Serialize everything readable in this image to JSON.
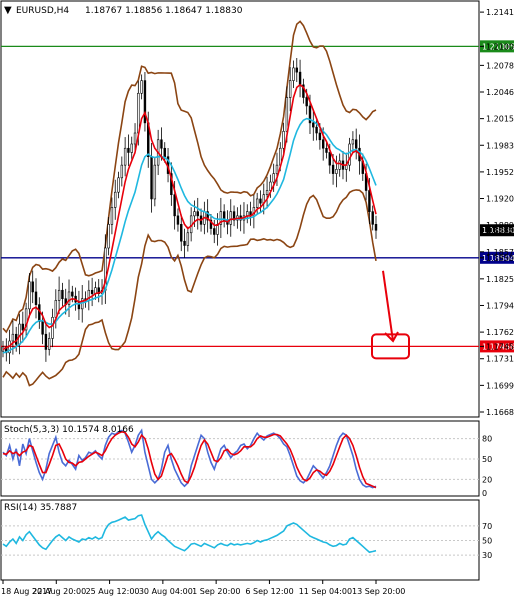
{
  "header": {
    "symbol_timeframe": "EURUSD,H4",
    "ohlc": "1.18767 1.18856 1.18647 1.18830"
  },
  "colors": {
    "up": "#000000",
    "down": "#000000",
    "ma_red": "#e8000b",
    "ma_cyan": "#1fb8e0",
    "bollinger": "#8b4513",
    "level_green": "#1a8a1a",
    "level_blue": "#00008b",
    "level_red": "#e8000b",
    "stoch_main": "#4a6cd6",
    "stoch_signal": "#e8000b",
    "rsi": "#1fb8e0",
    "arrow": "#e8000b"
  },
  "chart_data": [
    {
      "type": "candlestick",
      "title": "EURUSD,H4",
      "ylim": [
        1.1668,
        1.21435
      ],
      "y_ticks": [
        "1.21410",
        "1.21005",
        "1.20780",
        "1.20465",
        "1.20150",
        "1.19835",
        "1.19520",
        "1.19205",
        "1.18890",
        "1.18830",
        "1.18575",
        "1.18504",
        "1.18255",
        "1.17940",
        "1.17625",
        "1.17456",
        "1.17310",
        "1.16995",
        "1.16680"
      ],
      "price_label_current": "1.18830",
      "levels": [
        {
          "price": 1.21005,
          "label": "1.21005",
          "color": "#1a8a1a"
        },
        {
          "price": 1.18504,
          "label": "1.18504",
          "color": "#00008b"
        },
        {
          "price": 1.17456,
          "label": "1.17456",
          "color": "#e8000b"
        }
      ],
      "x_labels": [
        "18 Aug 2017",
        "22 Aug 20:00",
        "25 Aug 12:00",
        "30 Aug 04:00",
        "1 Sep 20:00",
        "6 Sep 12:00",
        "11 Sep 04:00",
        "13 Sep 20:00"
      ],
      "close": [
        1.1745,
        1.1738,
        1.1752,
        1.176,
        1.1748,
        1.1772,
        1.1765,
        1.179,
        1.1822,
        1.181,
        1.1795,
        1.1775,
        1.176,
        1.1742,
        1.1755,
        1.178,
        1.18,
        1.1812,
        1.1802,
        1.1795,
        1.181,
        1.1805,
        1.1798,
        1.179,
        1.1802,
        1.18,
        1.1812,
        1.1808,
        1.1815,
        1.1808,
        1.1812,
        1.1862,
        1.189,
        1.191,
        1.1928,
        1.1945,
        1.196,
        1.198,
        1.1975,
        1.1985,
        1.1998,
        1.2045,
        1.206,
        1.201,
        1.197,
        1.192,
        1.196,
        1.199,
        1.198,
        1.197,
        1.195,
        1.1925,
        1.19,
        1.189,
        1.187,
        1.1865,
        1.188,
        1.19,
        1.1905,
        1.19,
        1.189,
        1.1905,
        1.1895,
        1.1885,
        1.1878,
        1.189,
        1.1905,
        1.1895,
        1.189,
        1.1905,
        1.1895,
        1.19,
        1.1895,
        1.19,
        1.1905,
        1.19,
        1.191,
        1.192,
        1.1915,
        1.1925,
        1.193,
        1.194,
        1.195,
        1.196,
        1.198,
        1.2,
        1.204,
        1.206,
        1.2075,
        1.207,
        1.2055,
        1.204,
        1.203,
        1.201,
        1.2005,
        1.1998,
        1.199,
        1.198,
        1.1975,
        1.196,
        1.195,
        1.1955,
        1.1965,
        1.1955,
        1.196,
        1.1985,
        1.199,
        1.198,
        1.1965,
        1.195,
        1.193,
        1.1905,
        1.189,
        1.1883
      ],
      "ma_red": [
        1.1742,
        1.1744,
        1.1746,
        1.175,
        1.1752,
        1.1758,
        1.1762,
        1.177,
        1.1782,
        1.179,
        1.1792,
        1.1788,
        1.1782,
        1.1772,
        1.1768,
        1.177,
        1.1778,
        1.1788,
        1.1792,
        1.1795,
        1.18,
        1.1802,
        1.1801,
        1.1798,
        1.1799,
        1.18,
        1.1803,
        1.1805,
        1.1808,
        1.1809,
        1.181,
        1.1822,
        1.184,
        1.186,
        1.188,
        1.19,
        1.192,
        1.194,
        1.1955,
        1.1965,
        1.1975,
        1.1995,
        1.2015,
        1.2022,
        1.201,
        1.199,
        1.198,
        1.1975,
        1.197,
        1.1965,
        1.1958,
        1.1945,
        1.193,
        1.1915,
        1.19,
        1.189,
        1.1885,
        1.1888,
        1.1893,
        1.1896,
        1.1895,
        1.1898,
        1.1897,
        1.1893,
        1.1889,
        1.1889,
        1.1893,
        1.1894,
        1.1893,
        1.1896,
        1.1896,
        1.1897,
        1.1897,
        1.1898,
        1.19,
        1.19,
        1.1903,
        1.1908,
        1.191,
        1.1915,
        1.192,
        1.1928,
        1.1936,
        1.1945,
        1.1958,
        1.1972,
        1.1995,
        1.2018,
        1.204,
        1.2052,
        1.2055,
        1.2052,
        1.2045,
        1.2035,
        1.2025,
        1.2015,
        1.2005,
        1.1995,
        1.1988,
        1.1978,
        1.1968,
        1.1962,
        1.1962,
        1.196,
        1.196,
        1.1968,
        1.1975,
        1.1977,
        1.1973,
        1.1965,
        1.1952,
        1.1935,
        1.1918,
        1.1902
      ],
      "ma_cyan": [
        1.1738,
        1.1739,
        1.1741,
        1.1743,
        1.1745,
        1.1748,
        1.1752,
        1.1757,
        1.1764,
        1.177,
        1.1774,
        1.1776,
        1.1776,
        1.1774,
        1.1772,
        1.1772,
        1.1775,
        1.178,
        1.1784,
        1.1787,
        1.1791,
        1.1794,
        1.1796,
        1.1796,
        1.1797,
        1.1798,
        1.18,
        1.1801,
        1.1803,
        1.1804,
        1.1806,
        1.1813,
        1.1824,
        1.1836,
        1.185,
        1.1864,
        1.1878,
        1.1893,
        1.1906,
        1.1917,
        1.1928,
        1.1944,
        1.196,
        1.197,
        1.1973,
        1.197,
        1.1969,
        1.197,
        1.197,
        1.1969,
        1.1966,
        1.196,
        1.1952,
        1.1943,
        1.1933,
        1.1924,
        1.1917,
        1.1913,
        1.1911,
        1.1909,
        1.1906,
        1.1905,
        1.1903,
        1.19,
        1.1897,
        1.1896,
        1.1896,
        1.1896,
        1.1895,
        1.1896,
        1.1896,
        1.1896,
        1.1896,
        1.1897,
        1.1897,
        1.1898,
        1.1899,
        1.1902,
        1.1904,
        1.1907,
        1.191,
        1.1915,
        1.192,
        1.1926,
        1.1934,
        1.1943,
        1.1958,
        1.1973,
        1.1989,
        1.2,
        1.2008,
        1.2013,
        1.2015,
        1.2014,
        1.2012,
        1.2009,
        1.2005,
        1.2,
        1.1996,
        1.199,
        1.1984,
        1.198,
        1.1978,
        1.1975,
        1.1973,
        1.1975,
        1.1978,
        1.1978,
        1.1976,
        1.1972,
        1.1965,
        1.1956,
        1.1946,
        1.1936
      ]
    },
    {
      "type": "line",
      "title": "Stoch(5,3,3) 10.1574 8.0166",
      "ylim": [
        0,
        100
      ],
      "y_ticks": [
        "80",
        "50",
        "20",
        "0"
      ],
      "series": [
        {
          "name": "main",
          "values": [
            60,
            55,
            70,
            50,
            65,
            40,
            72,
            58,
            80,
            62,
            45,
            30,
            20,
            35,
            58,
            70,
            82,
            60,
            45,
            40,
            48,
            42,
            35,
            55,
            48,
            52,
            60,
            58,
            62,
            55,
            50,
            70,
            82,
            88,
            86,
            90,
            92,
            88,
            75,
            60,
            70,
            85,
            92,
            60,
            40,
            20,
            15,
            20,
            35,
            60,
            70,
            50,
            35,
            25,
            15,
            10,
            15,
            40,
            55,
            70,
            85,
            80,
            60,
            45,
            35,
            50,
            65,
            70,
            60,
            52,
            58,
            62,
            70,
            72,
            65,
            70,
            80,
            88,
            82,
            78,
            84,
            86,
            88,
            85,
            80,
            72,
            68,
            55,
            40,
            25,
            18,
            15,
            20,
            30,
            40,
            35,
            28,
            22,
            30,
            40,
            55,
            70,
            82,
            88,
            85,
            70,
            55,
            35,
            20,
            12,
            9,
            10,
            8,
            10
          ]
        },
        {
          "name": "signal",
          "values": [
            58,
            57,
            62,
            58,
            60,
            55,
            60,
            62,
            70,
            68,
            55,
            42,
            30,
            30,
            42,
            55,
            70,
            72,
            62,
            50,
            45,
            44,
            40,
            45,
            46,
            50,
            54,
            57,
            60,
            58,
            55,
            62,
            72,
            80,
            85,
            88,
            90,
            89,
            82,
            72,
            68,
            75,
            85,
            80,
            65,
            45,
            28,
            20,
            25,
            40,
            55,
            58,
            50,
            40,
            28,
            18,
            15,
            25,
            38,
            55,
            70,
            78,
            72,
            60,
            48,
            46,
            52,
            62,
            64,
            58,
            56,
            58,
            62,
            68,
            68,
            68,
            72,
            80,
            84,
            82,
            82,
            84,
            86,
            86,
            84,
            78,
            72,
            64,
            52,
            38,
            28,
            20,
            18,
            22,
            30,
            34,
            32,
            28,
            26,
            32,
            42,
            55,
            68,
            80,
            85,
            80,
            70,
            55,
            38,
            24,
            14,
            12,
            10,
            8
          ]
        }
      ]
    },
    {
      "type": "line",
      "title": "RSI(14) 35.7887",
      "ylim": [
        0,
        100
      ],
      "y_ticks": [
        "70",
        "50",
        "30"
      ],
      "series": [
        {
          "name": "rsi",
          "values": [
            45,
            42,
            48,
            52,
            46,
            55,
            50,
            58,
            62,
            56,
            50,
            44,
            40,
            38,
            44,
            50,
            55,
            58,
            54,
            50,
            55,
            52,
            50,
            48,
            52,
            51,
            54,
            52,
            55,
            52,
            54,
            65,
            72,
            75,
            76,
            78,
            80,
            82,
            78,
            79,
            80,
            84,
            85,
            72,
            62,
            52,
            58,
            62,
            58,
            55,
            50,
            46,
            42,
            40,
            38,
            36,
            40,
            45,
            46,
            44,
            42,
            46,
            44,
            42,
            40,
            44,
            46,
            44,
            43,
            46,
            44,
            45,
            44,
            45,
            46,
            45,
            47,
            50,
            48,
            50,
            51,
            53,
            55,
            57,
            60,
            63,
            70,
            72,
            74,
            72,
            68,
            64,
            60,
            56,
            54,
            52,
            50,
            48,
            47,
            44,
            42,
            43,
            46,
            44,
            45,
            52,
            54,
            50,
            46,
            42,
            38,
            34,
            35,
            36
          ]
        }
      ]
    }
  ]
}
